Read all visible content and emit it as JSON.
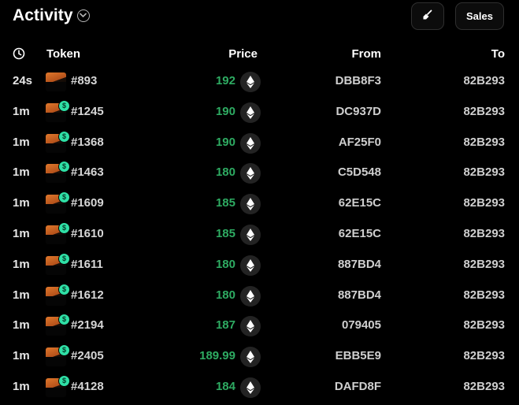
{
  "header": {
    "title": "Activity",
    "sales_label": "Sales",
    "accent": "#2eab62",
    "badge_color": "#2fe0a6",
    "clean_icon": "broom-icon"
  },
  "columns": {
    "token": "Token",
    "price": "Price",
    "from": "From",
    "to": "To",
    "time_icon": "clock-icon"
  },
  "rows": [
    {
      "time": "24s",
      "token": "#893",
      "badge": false,
      "price": "192",
      "from": "DBB8F3",
      "to": "82B293"
    },
    {
      "time": "1m",
      "token": "#1245",
      "badge": true,
      "price": "190",
      "from": "DC937D",
      "to": "82B293"
    },
    {
      "time": "1m",
      "token": "#1368",
      "badge": true,
      "price": "190",
      "from": "AF25F0",
      "to": "82B293"
    },
    {
      "time": "1m",
      "token": "#1463",
      "badge": true,
      "price": "180",
      "from": "C5D548",
      "to": "82B293"
    },
    {
      "time": "1m",
      "token": "#1609",
      "badge": true,
      "price": "185",
      "from": "62E15C",
      "to": "82B293"
    },
    {
      "time": "1m",
      "token": "#1610",
      "badge": true,
      "price": "185",
      "from": "62E15C",
      "to": "82B293"
    },
    {
      "time": "1m",
      "token": "#1611",
      "badge": true,
      "price": "180",
      "from": "887BD4",
      "to": "82B293"
    },
    {
      "time": "1m",
      "token": "#1612",
      "badge": true,
      "price": "180",
      "from": "887BD4",
      "to": "82B293"
    },
    {
      "time": "1m",
      "token": "#2194",
      "badge": true,
      "price": "187",
      "from": "079405",
      "to": "82B293"
    },
    {
      "time": "1m",
      "token": "#2405",
      "badge": true,
      "price": "189.99",
      "from": "EBB5E9",
      "to": "82B293"
    },
    {
      "time": "1m",
      "token": "#4128",
      "badge": true,
      "price": "184",
      "from": "DAFD8F",
      "to": "82B293"
    }
  ]
}
